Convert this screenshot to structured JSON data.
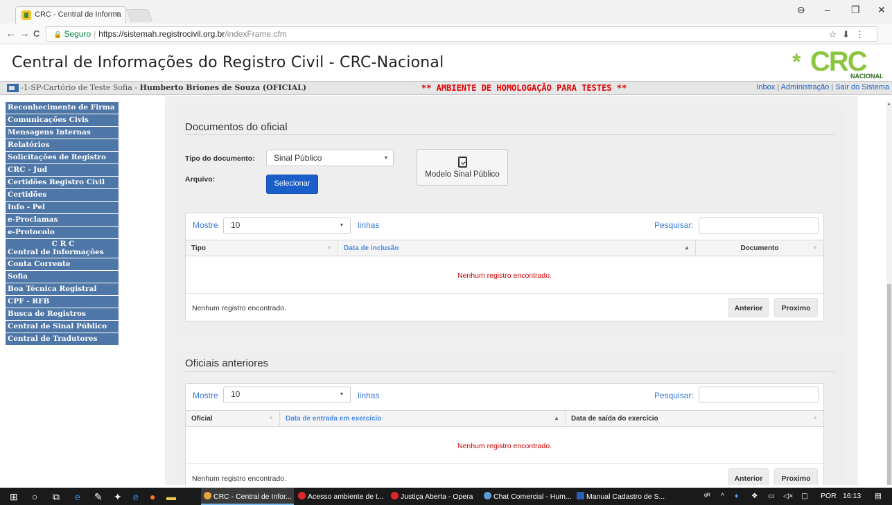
{
  "browser": {
    "tab_title": "CRC - Central de Informa",
    "tab_close": "×",
    "url_secure": "Seguro",
    "url_separator": "|",
    "url_host": "https://sistemah.registrocivil.org.br",
    "url_path": "/indexFrame.cfm",
    "back_icon": "←",
    "forward_icon": "→",
    "reload_icon": "C",
    "bookmark_icon": "☆",
    "extension_icon": "⬇",
    "menu_icon": "⋮",
    "profile_icon": "⊖",
    "minimize_icon": "–",
    "maximize_icon": "❐",
    "close_icon": "✕"
  },
  "header": {
    "title": "Central de Informações do Registro Civil - CRC-Nacional",
    "logo_star": "*",
    "logo_text": "CRC",
    "logo_sub": "NACIONAL"
  },
  "infobar": {
    "cartorio": "-1-SP-Cartório de Teste Sofia - ",
    "user": "Humberto Briones de Souza (OFICIAL)",
    "ambiente": "** AMBIENTE DE HOMOLOGAÇÃO PARA TESTES **",
    "inbox": "Inbox",
    "admin": "Administração",
    "sair": "Sair do Sistema",
    "sep": "|"
  },
  "sidebar": {
    "items": [
      "Reconhecimento de Firma",
      "Comunicações Civis",
      "Mensagens Internas",
      "Relatórios",
      "Solicitações de Registro",
      "CRC - Jud",
      "Certidões Registro Civil",
      "Certidões",
      "Info - Pel",
      "e-Proclamas",
      "e-Protocolo"
    ],
    "crc_line1": "C R C",
    "crc_line2": "Central de Informações",
    "items2": [
      "Conta Corrente",
      "Sofia",
      "Boa Técnica Registral",
      "CPF - RFB",
      "Busca de Registros",
      "Central de Sinal Público",
      "Central de Tradutores"
    ]
  },
  "documentos": {
    "heading": "Documentos do oficial",
    "tipo_label": "Tipo do documento:",
    "tipo_value": "Sinal Público",
    "arquivo_label": "Arquivo:",
    "selecionar": "Selecionar",
    "modelo": "Modelo Sinal Público",
    "caret": "▾"
  },
  "table1": {
    "mostre": "Mostre",
    "length": "10",
    "linhas": "linhas",
    "pesquisar": "Pesquisar:",
    "search_value": "",
    "columns": [
      "Tipo",
      "Data de inclusão",
      "Documento"
    ],
    "sort_icon": "▼",
    "sort_active_icon": "▲",
    "empty": "Nenhum registro encontrado.",
    "info": "Nenhum registro encontrado.",
    "anterior": "Anterior",
    "proximo": "Proximo"
  },
  "oficiais": {
    "heading": "Oficiais anteriores"
  },
  "table2": {
    "mostre": "Mostre",
    "length": "10",
    "linhas": "linhas",
    "pesquisar": "Pesquisar:",
    "search_value": "",
    "columns": [
      "Oficial",
      "Data de entrada em exercício",
      "Data de saída do exercício"
    ],
    "sort_icon": "▼",
    "sort_active_icon": "▲",
    "empty": "Nenhum registro encontrado.",
    "info": "Nenhum registro encontrado.",
    "anterior": "Anterior",
    "proximo": "Proximo"
  },
  "taskbar": {
    "apps": [
      "CRC - Central de Infor...",
      "Acesso ambiente de t...",
      "Justiça Aberta - Opera",
      "Chat Comercial - Hum...",
      "Manual Cadastro de S..."
    ],
    "lang": "POR",
    "time": "16:13"
  },
  "colors": {
    "sidebar": "#4e77a7",
    "accent_blue": "#1a5fc9",
    "alert_red": "#e00000",
    "logo_green": "#8cc63f"
  }
}
